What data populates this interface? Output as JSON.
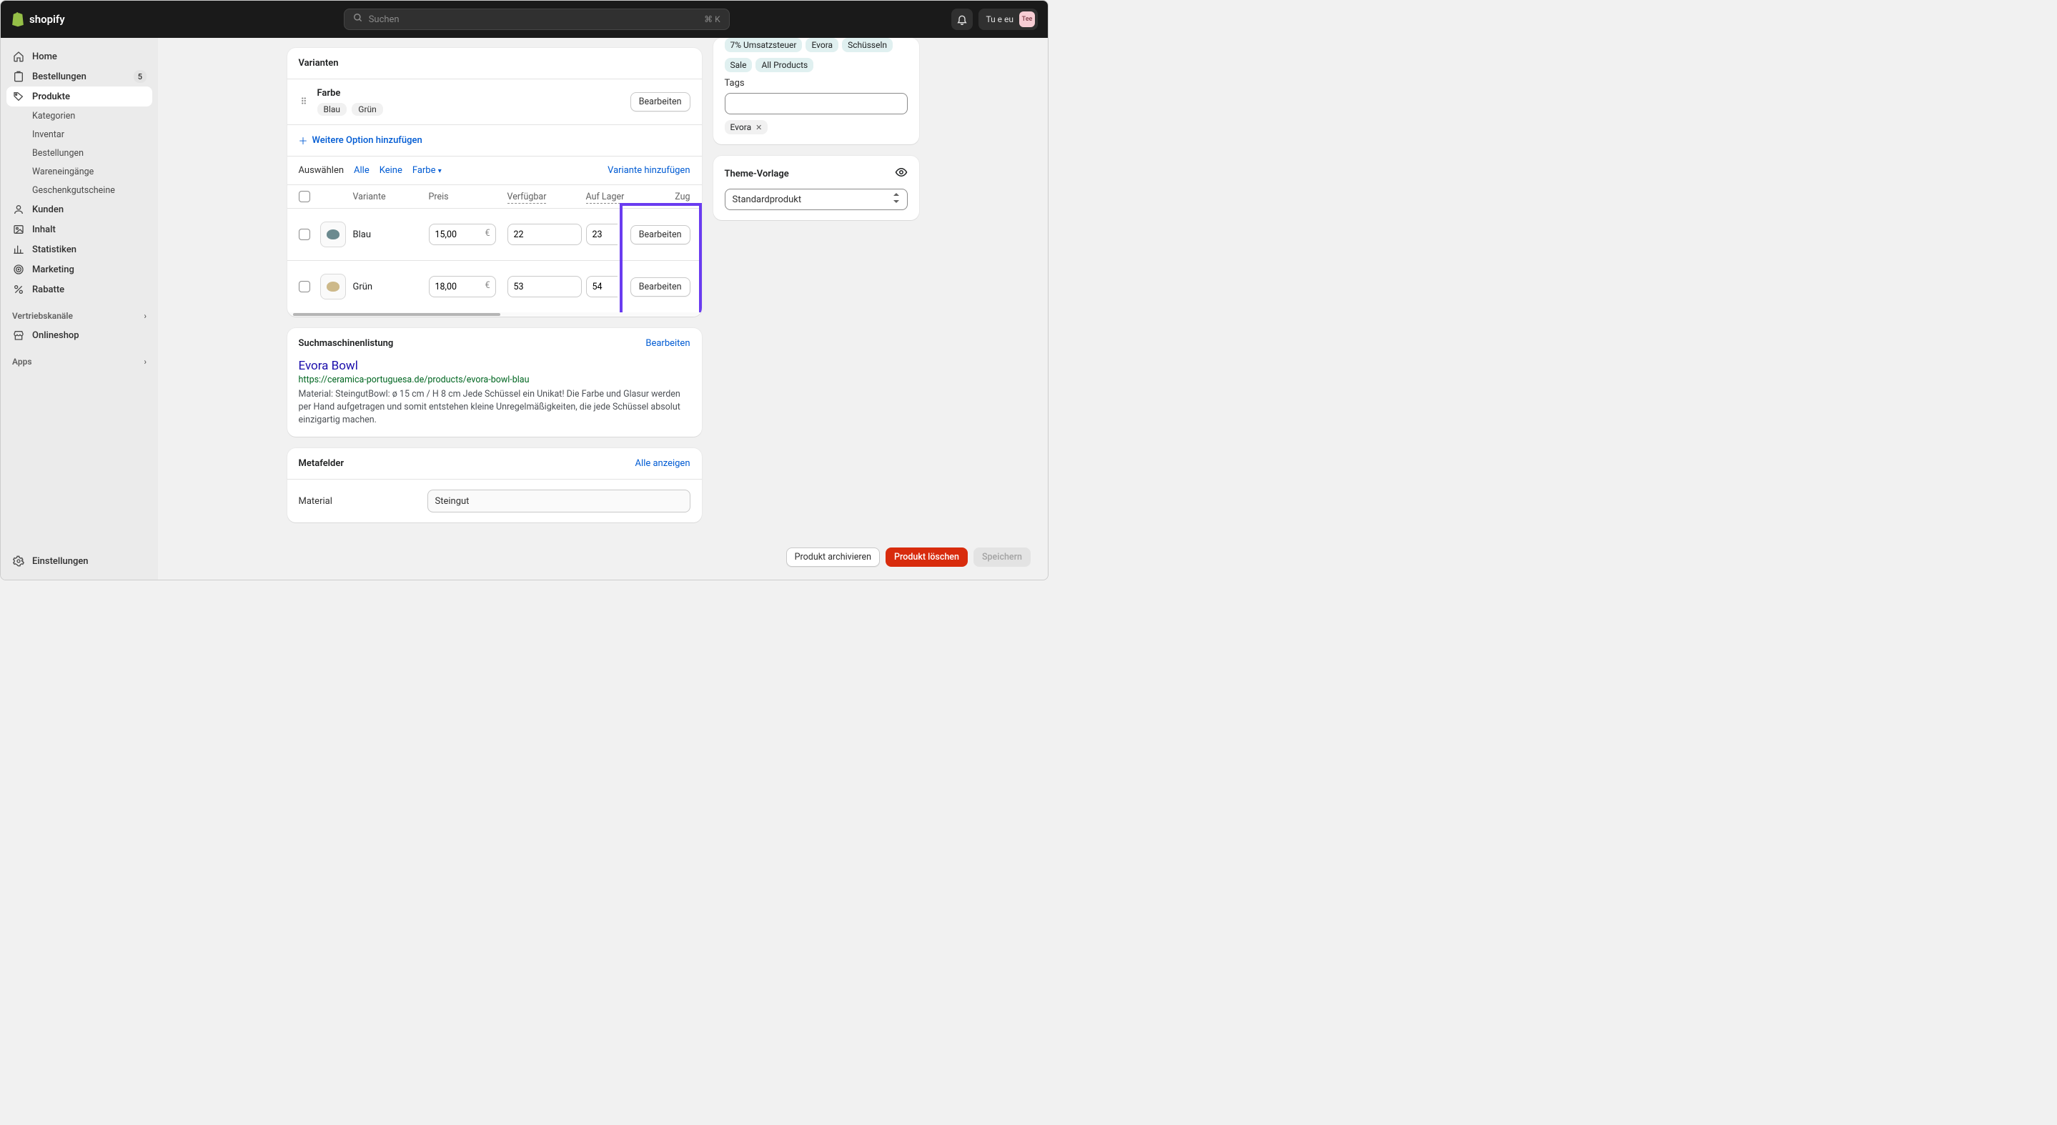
{
  "search": {
    "placeholder": "Suchen",
    "shortcut": "⌘ K"
  },
  "user": {
    "name": "Tu e eu",
    "initials": "Tee"
  },
  "nav": {
    "home": "Home",
    "orders": "Bestellungen",
    "orders_badge": "5",
    "products": "Produkte",
    "categories": "Kategorien",
    "inventory": "Inventar",
    "purchase_orders": "Bestellungen",
    "transfers": "Wareneingänge",
    "gift_cards": "Geschenkgutscheine",
    "customers": "Kunden",
    "content": "Inhalt",
    "analytics": "Statistiken",
    "marketing": "Marketing",
    "discounts": "Rabatte",
    "channels_heading": "Vertriebskanäle",
    "online_store": "Onlineshop",
    "apps_heading": "Apps",
    "settings": "Einstellungen"
  },
  "variants": {
    "title": "Varianten",
    "option_name": "Farbe",
    "option_edit": "Bearbeiten",
    "values": [
      "Blau",
      "Grün"
    ],
    "add_option": "Weitere Option hinzufügen",
    "select_label": "Auswählen",
    "filter_all": "Alle",
    "filter_none": "Keine",
    "filter_color": "Farbe",
    "add_variant": "Variante hinzufügen",
    "head_variant": "Variante",
    "head_price": "Preis",
    "head_available": "Verfügbar",
    "head_onhand": "Auf Lager",
    "head_trailing": "Zug",
    "currency": "€",
    "rows": [
      {
        "name": "Blau",
        "price": "15,00",
        "available": "22",
        "onhand": "23",
        "edit": "Bearbeiten",
        "thumb": "#6b8a8f"
      },
      {
        "name": "Grün",
        "price": "18,00",
        "available": "53",
        "onhand": "54",
        "edit": "Bearbeiten",
        "thumb": "#cdb98a"
      }
    ]
  },
  "seo": {
    "heading": "Suchmaschinenlistung",
    "edit": "Bearbeiten",
    "title": "Evora Bowl",
    "url": "https://ceramica-portuguesa.de/products/evora-bowl-blau",
    "desc": "Material: SteingutBowl: ø 15 cm / H 8 cm Jede Schüssel ein Unikat! Die Farbe und Glasur werden per Hand aufgetragen und somit entstehen kleine Unregelmäßigkeiten, die jede Schüssel absolut einzigartig machen."
  },
  "meta": {
    "heading": "Metafelder",
    "show_all": "Alle anzeigen",
    "label": "Material",
    "value": "Steingut"
  },
  "right": {
    "collections": [
      "7% Umsatzsteuer",
      "Evora",
      "Schüsseln",
      "Sale",
      "All Products"
    ],
    "tags_label": "Tags",
    "tags": [
      "Evora"
    ],
    "theme_heading": "Theme-Vorlage",
    "theme_value": "Standardprodukt"
  },
  "footer": {
    "archive": "Produkt archivieren",
    "delete": "Produkt löschen",
    "save": "Speichern"
  }
}
